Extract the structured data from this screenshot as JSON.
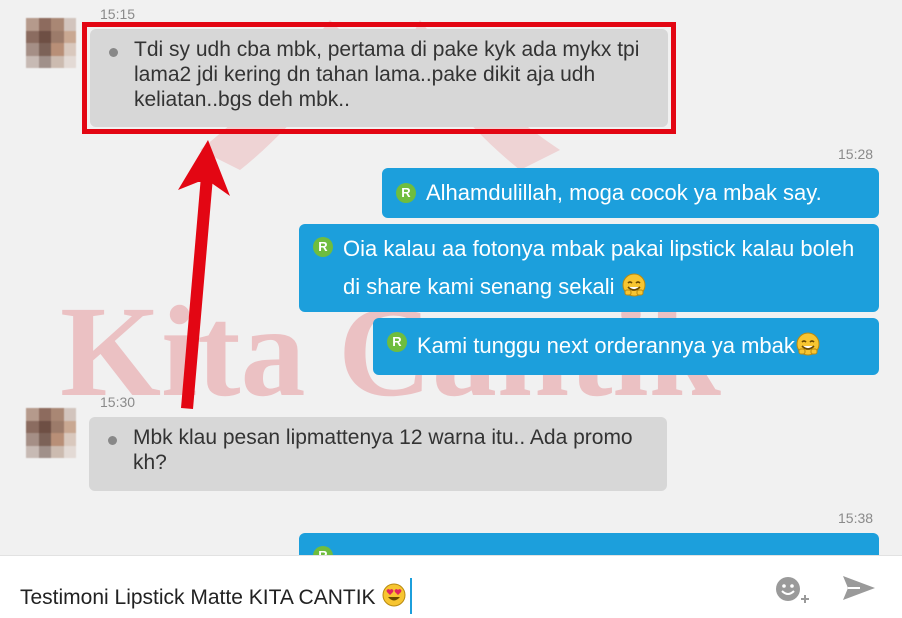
{
  "watermark": {
    "text": "Kita Cantik",
    "color": "#e79a9f"
  },
  "messages": [
    {
      "direction": "incoming",
      "time": "15:15",
      "text": "Tdi sy udh cba mbk, pertama di pake kyk ada mykx tpi lama2 jdi kering dn tahan lama..pake dikit aja udh keliatan..bgs deh mbk..",
      "highlighted": true
    },
    {
      "direction": "outgoing",
      "time": "15:28",
      "badge": "R",
      "text": "Alhamdulillah, moga cocok ya mbak say."
    },
    {
      "direction": "outgoing",
      "badge": "R",
      "text": "Oia kalau aa fotonya mbak pakai lipstick kalau boleh di share kami senang sekali",
      "emoji": "smiling-face-icon"
    },
    {
      "direction": "outgoing",
      "badge": "R",
      "text": "Kami tunggu next orderannya ya mbak",
      "emoji": "smiling-face-icon"
    },
    {
      "direction": "incoming",
      "time": "15:30",
      "text": "Mbk klau pesan lipmattenya 12 warna itu.. Ada promo kh?"
    },
    {
      "direction": "outgoing",
      "time": "15:38",
      "badge": "R",
      "text": ""
    }
  ],
  "composer": {
    "value": "Testimoni Lipstick Matte KITA CANTIK",
    "emoji": "heart-eyes-emoji-icon",
    "emoji_button": "emoji-add-icon",
    "send_button": "send-icon"
  },
  "colors": {
    "incoming_bubble": "#d7d7d7",
    "outgoing_bubble": "#1c9fdc",
    "highlight": "#e30613",
    "badge": "#6fbd3e"
  }
}
